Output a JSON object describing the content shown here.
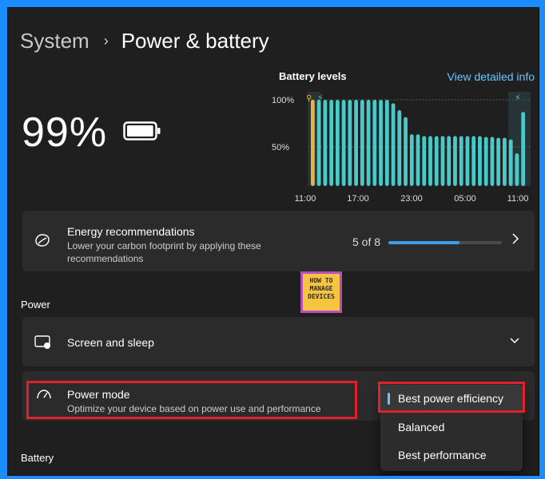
{
  "breadcrumb": {
    "parent": "System",
    "separator": "›",
    "current": "Power & battery"
  },
  "battery": {
    "percent": "99%",
    "level": 0.99
  },
  "chart": {
    "title": "Battery levels",
    "link": "View detailed info",
    "accent": "#4bc8c8",
    "charging_color": "#e7b14a",
    "chart_data": {
      "type": "bar",
      "ylabels": [
        "100%",
        "50%"
      ],
      "xlabels": [
        "11:00",
        "17:00",
        "23:00",
        "05:00",
        "11:00"
      ],
      "values": [
        100,
        100,
        100,
        100,
        100,
        100,
        100,
        100,
        100,
        100,
        100,
        100,
        100,
        96,
        88,
        80,
        60,
        60,
        58,
        58,
        58,
        58,
        58,
        58,
        58,
        58,
        58,
        58,
        57,
        57,
        56,
        56,
        54,
        38,
        86
      ],
      "charging_index": 0,
      "ylim": [
        0,
        100
      ]
    }
  },
  "energy": {
    "title": "Energy recommendations",
    "description": "Lower your carbon footprint by applying these recommendations",
    "count": "5 of 8",
    "progress": 0.625
  },
  "power_section": {
    "label": "Power"
  },
  "screen_sleep": {
    "label": "Screen and sleep"
  },
  "power_mode": {
    "title": "Power mode",
    "description": "Optimize your device based on power use and performance",
    "options": [
      "Best power efficiency",
      "Balanced",
      "Best performance"
    ],
    "selected": "Best power efficiency"
  },
  "battery_section": {
    "label": "Battery"
  },
  "watermark": {
    "line1": "HOW TO",
    "line2": "MANAGE",
    "line3": "DEVICES"
  }
}
